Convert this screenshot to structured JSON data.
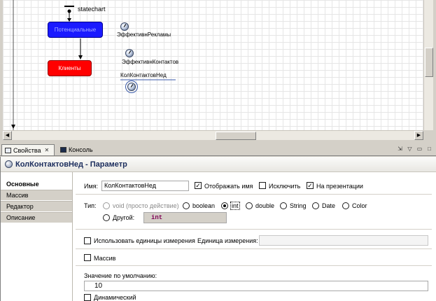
{
  "diagram": {
    "statechart_label": "statechart",
    "states": {
      "potential": "Потенциальные",
      "clients": "Клиенты"
    },
    "variables": [
      "ЭффективнРекламы",
      "ЭффективнКонтактов",
      "КолКонтактовНед"
    ]
  },
  "tabs": {
    "properties": "Свойства",
    "console": "Консоль"
  },
  "properties": {
    "title": "КолКонтактовНед - Параметр",
    "side_items": [
      "Основные",
      "Массив",
      "Редактор",
      "Описание"
    ],
    "name_label": "Имя:",
    "name_value": "КолКонтактовНед",
    "show_name_label": "Отображать имя",
    "exclude_label": "Исключить",
    "on_presentation_label": "На презентации",
    "type_label": "Тип:",
    "types": [
      "void (просто действие)",
      "boolean",
      "int",
      "double",
      "String",
      "Date",
      "Color"
    ],
    "other_label": "Другой:",
    "other_value": "int",
    "use_units_label": "Использовать единицы измерения",
    "units_label": "Единица измерения:",
    "array_label": "Массив",
    "default_value_label": "Значение по умолчанию:",
    "default_value": "10",
    "dynamic_label": "Динамический"
  }
}
